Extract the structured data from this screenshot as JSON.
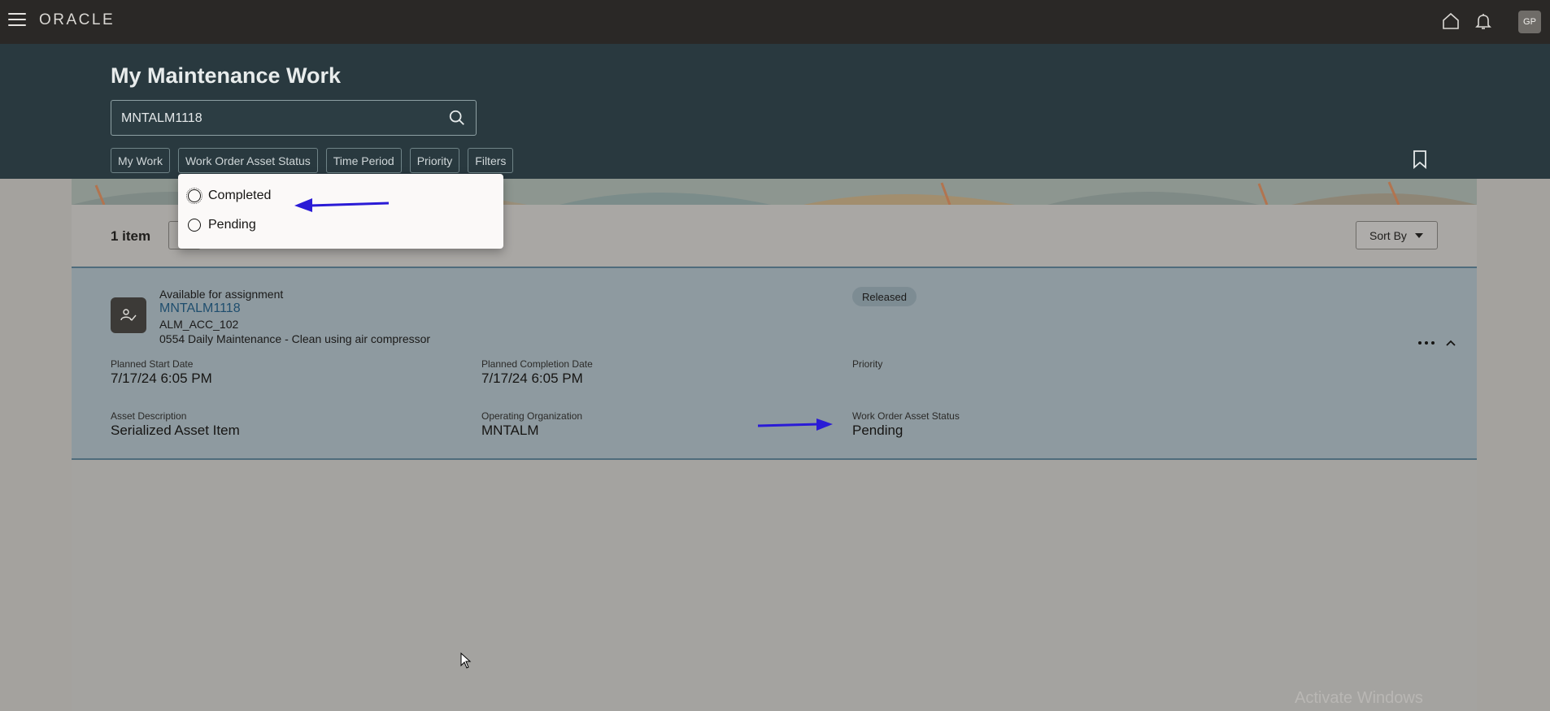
{
  "topbar": {
    "logo": "ORACLE",
    "user_initials": "GP"
  },
  "header": {
    "title": "My Maintenance Work",
    "search_value": "MNTALM1118",
    "chips": [
      "My Work",
      "Work Order Asset Status",
      "Time Period",
      "Priority",
      "Filters"
    ]
  },
  "results": {
    "count_label": "1 item",
    "sort_label": "Sort By"
  },
  "work_order": {
    "assignment_status": "Available for assignment",
    "number": "MNTALM1118",
    "asset_number": "ALM_ACC_102",
    "description": "0554 Daily Maintenance - Clean using air compressor",
    "badge": "Released",
    "fields": {
      "planned_start_label": "Planned Start Date",
      "planned_start_value": "7/17/24 6:05 PM",
      "planned_completion_label": "Planned Completion Date",
      "planned_completion_value": "7/17/24 6:05 PM",
      "priority_label": "Priority",
      "asset_description_label": "Asset Description",
      "asset_description_value": "Serialized Asset Item",
      "operating_org_label": "Operating Organization",
      "operating_org_value": "MNTALM",
      "asset_status_label": "Work Order Asset Status",
      "asset_status_value": "Pending"
    }
  },
  "status_popup": {
    "options": [
      "Completed",
      "Pending"
    ]
  },
  "watermark": "Activate Windows",
  "colors": {
    "topbar": "#2a2826",
    "header": "#29393f",
    "annotation_arrow": "#2a1bd6",
    "link": "#1f4e6e"
  }
}
